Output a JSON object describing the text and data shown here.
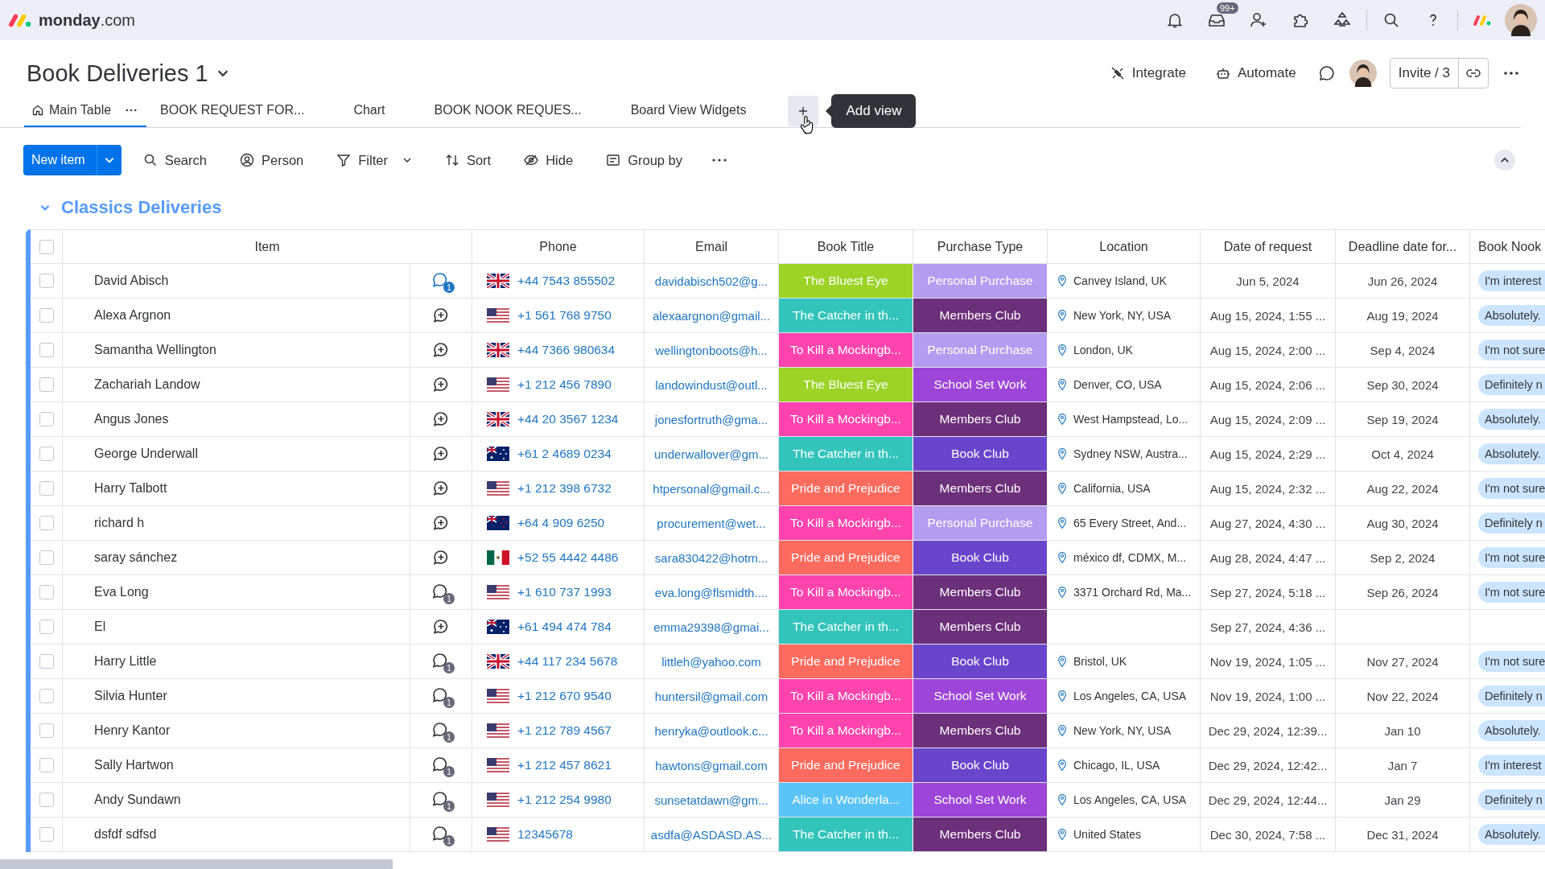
{
  "topbar": {
    "logo_name": "monday",
    "logo_suffix": ".com",
    "inbox_badge": "99+"
  },
  "board": {
    "title": "Book Deliveries 1",
    "actions": [
      {
        "kind": "integrate",
        "label": "Integrate"
      },
      {
        "kind": "automate",
        "label": "Automate"
      }
    ],
    "invite": "Invite / 3"
  },
  "tabs": [
    {
      "label": "Main Table",
      "selected": true,
      "home": true
    },
    {
      "label": "BOOK REQUEST FOR...",
      "selected": false,
      "home": false
    },
    {
      "label": "Chart",
      "selected": false,
      "home": false
    },
    {
      "label": "BOOK NOOK REQUES...",
      "selected": false,
      "home": false
    },
    {
      "label": "Board View Widgets",
      "selected": false,
      "home": false
    }
  ],
  "add_view_tooltip": "Add view",
  "toolbar": {
    "new_item": "New item",
    "tools": [
      {
        "kind": "search",
        "label": "Search"
      },
      {
        "kind": "person",
        "label": "Person"
      },
      {
        "kind": "filter",
        "label": "Filter"
      },
      {
        "kind": "sort",
        "label": "Sort"
      },
      {
        "kind": "hide",
        "label": "Hide"
      },
      {
        "kind": "group",
        "label": "Group by"
      }
    ]
  },
  "group": {
    "title": "Classics Deliveries",
    "expanded": true
  },
  "table": {
    "columns": [
      "Item",
      "Phone",
      "Email",
      "Book Title",
      "Purchase Type",
      "Location",
      "Date of request",
      "Deadline date for...",
      "Book Nook"
    ],
    "all_checked": false,
    "rows": [
      {
        "checked": false,
        "name": "David Abisch",
        "comments": {
          "kind": "updates",
          "count": "1",
          "unread": true
        },
        "flag": {
          "kind": "uk"
        },
        "phone": "+44 7543 855502",
        "email": "davidabisch502@g...",
        "book": {
          "text": "The Bluest Eye",
          "color": "#9cd326"
        },
        "purchase": {
          "text": "Personal Purchase",
          "color": "#b39df0"
        },
        "location": "Canvey Island, UK",
        "date": "Jun 5, 2024",
        "deadline": "Jun 26, 2024",
        "nook": "I'm interest"
      },
      {
        "checked": false,
        "name": "Alexa Argnon",
        "comments": {
          "kind": "add"
        },
        "flag": {
          "kind": "us"
        },
        "phone": "+1 561 768 9750",
        "email": "alexaargnon@gmail...",
        "book": {
          "text": "The Catcher in th...",
          "color": "#33c4bb"
        },
        "purchase": {
          "text": "Members Club",
          "color": "#6c2f7a"
        },
        "location": "New York, NY, USA",
        "date": "Aug 15, 2024, 1:55 ...",
        "deadline": "Aug 19, 2024",
        "nook": "Absolutely."
      },
      {
        "checked": false,
        "name": "Samantha Wellington",
        "comments": {
          "kind": "add"
        },
        "flag": {
          "kind": "uk"
        },
        "phone": "+44 7366 980634",
        "email": "wellingtonboots@h...",
        "book": {
          "text": "To Kill a Mockingb...",
          "color": "#ff44ad"
        },
        "purchase": {
          "text": "Personal Purchase",
          "color": "#b39df0"
        },
        "location": "London, UK",
        "date": "Aug 15, 2024, 2:00 ...",
        "deadline": "Sep 4, 2024",
        "nook": "I'm not sure"
      },
      {
        "checked": false,
        "name": "Zachariah Landow",
        "comments": {
          "kind": "add"
        },
        "flag": {
          "kind": "us"
        },
        "phone": "+1 212 456 7890",
        "email": "landowindust@outl...",
        "book": {
          "text": "The Bluest Eye",
          "color": "#9cd326"
        },
        "purchase": {
          "text": "School Set Work",
          "color": "#9d45d9"
        },
        "location": "Denver, CO, USA",
        "date": "Aug 15, 2024, 2:06 ...",
        "deadline": "Sep 30, 2024",
        "nook": "Definitely n"
      },
      {
        "checked": false,
        "name": "Angus Jones",
        "comments": {
          "kind": "add"
        },
        "flag": {
          "kind": "uk"
        },
        "phone": "+44 20 3567 1234",
        "email": "jonesfortruth@gma...",
        "book": {
          "text": "To Kill a Mockingb...",
          "color": "#ff44ad"
        },
        "purchase": {
          "text": "Members Club",
          "color": "#6c2f7a"
        },
        "location": "West Hampstead, Lo...",
        "date": "Aug 15, 2024, 2:09 ...",
        "deadline": "Sep 19, 2024",
        "nook": "Absolutely."
      },
      {
        "checked": false,
        "name": "George Underwall",
        "comments": {
          "kind": "add"
        },
        "flag": {
          "kind": "au"
        },
        "phone": "+61 2 4689 0234",
        "email": "underwallover@gm...",
        "book": {
          "text": "The Catcher in th...",
          "color": "#33c4bb"
        },
        "purchase": {
          "text": "Book Club",
          "color": "#6945cc"
        },
        "location": "Sydney NSW, Austra...",
        "date": "Aug 15, 2024, 2:29 ...",
        "deadline": "Oct 4, 2024",
        "nook": "Absolutely."
      },
      {
        "checked": false,
        "name": "Harry Talbott",
        "comments": {
          "kind": "add"
        },
        "flag": {
          "kind": "us"
        },
        "phone": "+1 212 398 6732",
        "email": "htpersonal@gmail.c...",
        "book": {
          "text": "Pride and Prejudice",
          "color": "#fd6b5f"
        },
        "purchase": {
          "text": "Members Club",
          "color": "#6c2f7a"
        },
        "location": "California, USA",
        "date": "Aug 15, 2024, 2:32 ...",
        "deadline": "Aug 22, 2024",
        "nook": "I'm not sure"
      },
      {
        "checked": false,
        "name": "richard h",
        "comments": {
          "kind": "add"
        },
        "flag": {
          "kind": "nz"
        },
        "phone": "+64 4 909 6250",
        "email": "procurement@wet...",
        "book": {
          "text": "To Kill a Mockingb...",
          "color": "#ff44ad"
        },
        "purchase": {
          "text": "Personal Purchase",
          "color": "#b39df0"
        },
        "location": "65 Every Street, And...",
        "date": "Aug 27, 2024, 4:30 ...",
        "deadline": "Aug 30, 2024",
        "nook": "Definitely n"
      },
      {
        "checked": false,
        "name": "saray sánchez",
        "comments": {
          "kind": "add"
        },
        "flag": {
          "kind": "mx"
        },
        "phone": "+52 55 4442 4486",
        "email": "sara830422@hotm...",
        "book": {
          "text": "Pride and Prejudice",
          "color": "#fd6b5f"
        },
        "purchase": {
          "text": "Book Club",
          "color": "#6945cc"
        },
        "location": "méxico df, CDMX, M...",
        "date": "Aug 28, 2024, 4:47 ...",
        "deadline": "Sep 2, 2024",
        "nook": "I'm not sure"
      },
      {
        "checked": false,
        "name": "Eva Long",
        "comments": {
          "kind": "updates",
          "count": "1",
          "unread": false
        },
        "flag": {
          "kind": "us"
        },
        "phone": "+1 610 737 1993",
        "email": "eva.long@flsmidth....",
        "book": {
          "text": "To Kill a Mockingb...",
          "color": "#ff44ad"
        },
        "purchase": {
          "text": "Members Club",
          "color": "#6c2f7a"
        },
        "location": "3371 Orchard Rd, Ma...",
        "date": "Sep 27, 2024, 5:18 ...",
        "deadline": "Sep 26, 2024",
        "nook": "I'm not sure"
      },
      {
        "checked": false,
        "name": "El",
        "comments": {
          "kind": "add"
        },
        "flag": {
          "kind": "au"
        },
        "phone": "+61 494 474 784",
        "email": "emma29398@gmai...",
        "book": {
          "text": "The Catcher in th...",
          "color": "#33c4bb"
        },
        "purchase": {
          "text": "Members Club",
          "color": "#6c2f7a"
        },
        "date": "Sep 27, 2024, 4:36 ..."
      },
      {
        "checked": false,
        "name": "Harry Little",
        "comments": {
          "kind": "updates",
          "count": "1",
          "unread": false
        },
        "flag": {
          "kind": "uk"
        },
        "phone": "+44 117 234 5678",
        "email": "littleh@yahoo.com",
        "book": {
          "text": "Pride and Prejudice",
          "color": "#fd6b5f"
        },
        "purchase": {
          "text": "Book Club",
          "color": "#6945cc"
        },
        "location": "Bristol, UK",
        "date": "Nov 19, 2024, 1:05 ...",
        "deadline": "Nov 27, 2024",
        "nook": "I'm not sure"
      },
      {
        "checked": false,
        "name": "Silvia Hunter",
        "comments": {
          "kind": "updates",
          "count": "1",
          "unread": false
        },
        "flag": {
          "kind": "us"
        },
        "phone": "+1 212 670 9540",
        "email": "huntersil@gmail.com",
        "book": {
          "text": "To Kill a Mockingb...",
          "color": "#ff44ad"
        },
        "purchase": {
          "text": "School Set Work",
          "color": "#9d45d9"
        },
        "location": "Los Angeles, CA, USA",
        "date": "Nov 19, 2024, 1:00 ...",
        "deadline": "Nov 22, 2024",
        "nook": "Definitely n"
      },
      {
        "checked": false,
        "name": "Henry Kantor",
        "comments": {
          "kind": "updates",
          "count": "1",
          "unread": false
        },
        "flag": {
          "kind": "us"
        },
        "phone": "+1 212 789 4567",
        "email": "henryka@outlook.c...",
        "book": {
          "text": "To Kill a Mockingb...",
          "color": "#ff44ad"
        },
        "purchase": {
          "text": "Members Club",
          "color": "#6c2f7a"
        },
        "location": "New York, NY, USA",
        "date": "Dec 29, 2024, 12:39...",
        "deadline": "Jan 10",
        "nook": "Absolutely."
      },
      {
        "checked": false,
        "name": "Sally Hartwon",
        "comments": {
          "kind": "updates",
          "count": "1",
          "unread": false
        },
        "flag": {
          "kind": "us"
        },
        "phone": "+1 212 457 8621",
        "email": "hawtons@gmail.com",
        "book": {
          "text": "Pride and Prejudice",
          "color": "#fd6b5f"
        },
        "purchase": {
          "text": "Book Club",
          "color": "#6945cc"
        },
        "location": "Chicago, IL, USA",
        "date": "Dec 29, 2024, 12:42...",
        "deadline": "Jan 7",
        "nook": "I'm interest"
      },
      {
        "checked": false,
        "name": "Andy Sundawn",
        "comments": {
          "kind": "updates",
          "count": "1",
          "unread": false
        },
        "flag": {
          "kind": "us"
        },
        "phone": "+1 212 254 9980",
        "email": "sunsetatdawn@gm...",
        "book": {
          "text": "Alice in Wonderla...",
          "color": "#5ac4f8"
        },
        "purchase": {
          "text": "School Set Work",
          "color": "#9d45d9"
        },
        "location": "Los Angeles, CA, USA",
        "date": "Dec 29, 2024, 12:44...",
        "deadline": "Jan 29",
        "nook": "Definitely n"
      },
      {
        "checked": false,
        "name": "dsfdf sdfsd",
        "comments": {
          "kind": "updates",
          "count": "1",
          "unread": false
        },
        "flag": {
          "kind": "us"
        },
        "phone": "12345678",
        "email": "asdfa@ASDASD.AS...",
        "book": {
          "text": "The Catcher in th...",
          "color": "#33c4bb"
        },
        "purchase": {
          "text": "Members Club",
          "color": "#6c2f7a"
        },
        "location": "United States",
        "date": "Dec 30, 2024, 7:58 ...",
        "deadline": "Dec 31, 2024",
        "nook": "Absolutely."
      }
    ]
  }
}
